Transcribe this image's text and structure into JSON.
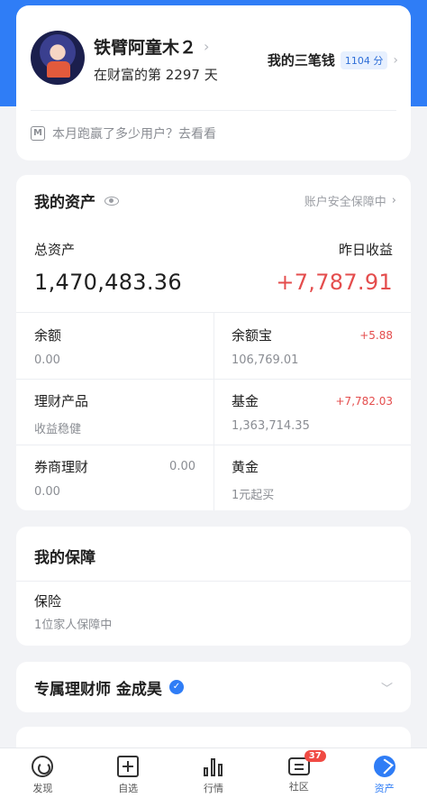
{
  "profile": {
    "username": "铁臂阿童木２",
    "days_text": "在财富的第 2297 天",
    "three_money_label": "我的三笔钱",
    "points_badge": "1104 分",
    "run_prompt": "本月跑赢了多少用户？去看看",
    "run_icon_letter": "M"
  },
  "assets": {
    "title": "我的资产",
    "security_text": "账户安全保障中",
    "total_label": "总资产",
    "total_value": "1,470,483.36",
    "yesterday_label": "昨日收益",
    "yesterday_value": "+7,787.91",
    "items": [
      {
        "name": "余额",
        "value": "0.00",
        "change": ""
      },
      {
        "name": "余额宝",
        "value": "106,769.01",
        "change": "+5.88"
      },
      {
        "name": "理财产品",
        "value": "收益稳健",
        "change": ""
      },
      {
        "name": "基金",
        "value": "1,363,714.35",
        "change": "+7,782.03"
      },
      {
        "name": "券商理财",
        "value": "0.00",
        "change": "0.00"
      },
      {
        "name": "黄金",
        "value": "1元起买",
        "change": ""
      }
    ]
  },
  "insurance": {
    "title": "我的保障",
    "item_name": "保险",
    "item_sub": "1位家人保障中"
  },
  "advisor": {
    "title": "专属理财师 金成昊"
  },
  "tabs": [
    {
      "label": "发现"
    },
    {
      "label": "自选"
    },
    {
      "label": "行情"
    },
    {
      "label": "社区",
      "badge": "37"
    },
    {
      "label": "资产"
    }
  ],
  "colors": {
    "accent": "#2f7df6",
    "gain": "#e44d4d"
  }
}
